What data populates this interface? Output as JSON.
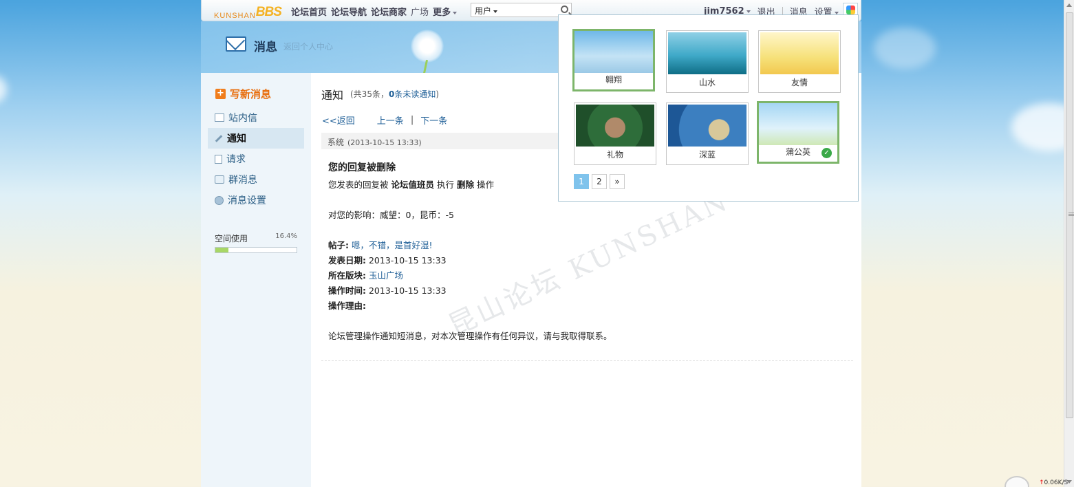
{
  "topbar": {
    "logo_prefix": "KUNSHAN",
    "logo_main": "BBS",
    "nav": [
      "论坛首页",
      "论坛导航",
      "论坛商家",
      "广场"
    ],
    "more": "更多",
    "search_type": "用户",
    "username": "jim7562",
    "logout": "退出",
    "messages": "消息",
    "settings": "设置"
  },
  "header": {
    "title": "消息",
    "back_link": "返回个人中心"
  },
  "sidebar": {
    "compose": "写新消息",
    "items": [
      {
        "label": "站内信",
        "icon": "mail-icon"
      },
      {
        "label": "通知",
        "icon": "pencil-icon"
      },
      {
        "label": "请求",
        "icon": "document-icon"
      },
      {
        "label": "群消息",
        "icon": "chat-bubble-icon"
      },
      {
        "label": "消息设置",
        "icon": "gear-icon"
      }
    ],
    "space_label": "空间使用",
    "space_pct": "16.4%",
    "space_fraction": 0.164
  },
  "main": {
    "title": "通知",
    "count_prefix": "(共35条，",
    "unread_count": "0",
    "unread_suffix": "条未读通知",
    "count_close": ")",
    "back": "<<返回",
    "prev": "上一条",
    "divider": "|",
    "next": "下一条",
    "sender": "系统",
    "time": "(2013-10-15 13:33)",
    "msg_title": "您的回复被删除",
    "line1_a": "您发表的回复被",
    "line1_actor": "论坛值班员",
    "line1_b": "执行",
    "line1_action": "删除",
    "line1_c": "操作",
    "impact": "对您的影响：威望：0，昆币：-5",
    "post_label": "帖子:",
    "post_value": "嗯，不错，是首好湿!",
    "date_label": "发表日期:",
    "date_value": "2013-10-15 13:33",
    "board_label": "所在版块:",
    "board_value": "玉山广场",
    "optime_label": "操作时间:",
    "optime_value": "2013-10-15 13:33",
    "reason_label": "操作理由:",
    "footer": "论坛管理操作通知短消息，对本次管理操作有任何异议，请与我取得联系。",
    "watermark": "昆山论坛 KUNSHAN BBS"
  },
  "skins": {
    "items": [
      {
        "name": "翱翔",
        "selected": true,
        "checked": false
      },
      {
        "name": "山水",
        "selected": false,
        "checked": false
      },
      {
        "name": "友情",
        "selected": false,
        "checked": false
      },
      {
        "name": "礼物",
        "selected": false,
        "checked": false
      },
      {
        "name": "深蓝",
        "selected": false,
        "checked": false
      },
      {
        "name": "蒲公英",
        "selected": true,
        "checked": true
      }
    ],
    "pages": [
      "1",
      "2",
      "»"
    ],
    "current_page": "1"
  },
  "status": {
    "net_speed": "0.06K/S"
  }
}
